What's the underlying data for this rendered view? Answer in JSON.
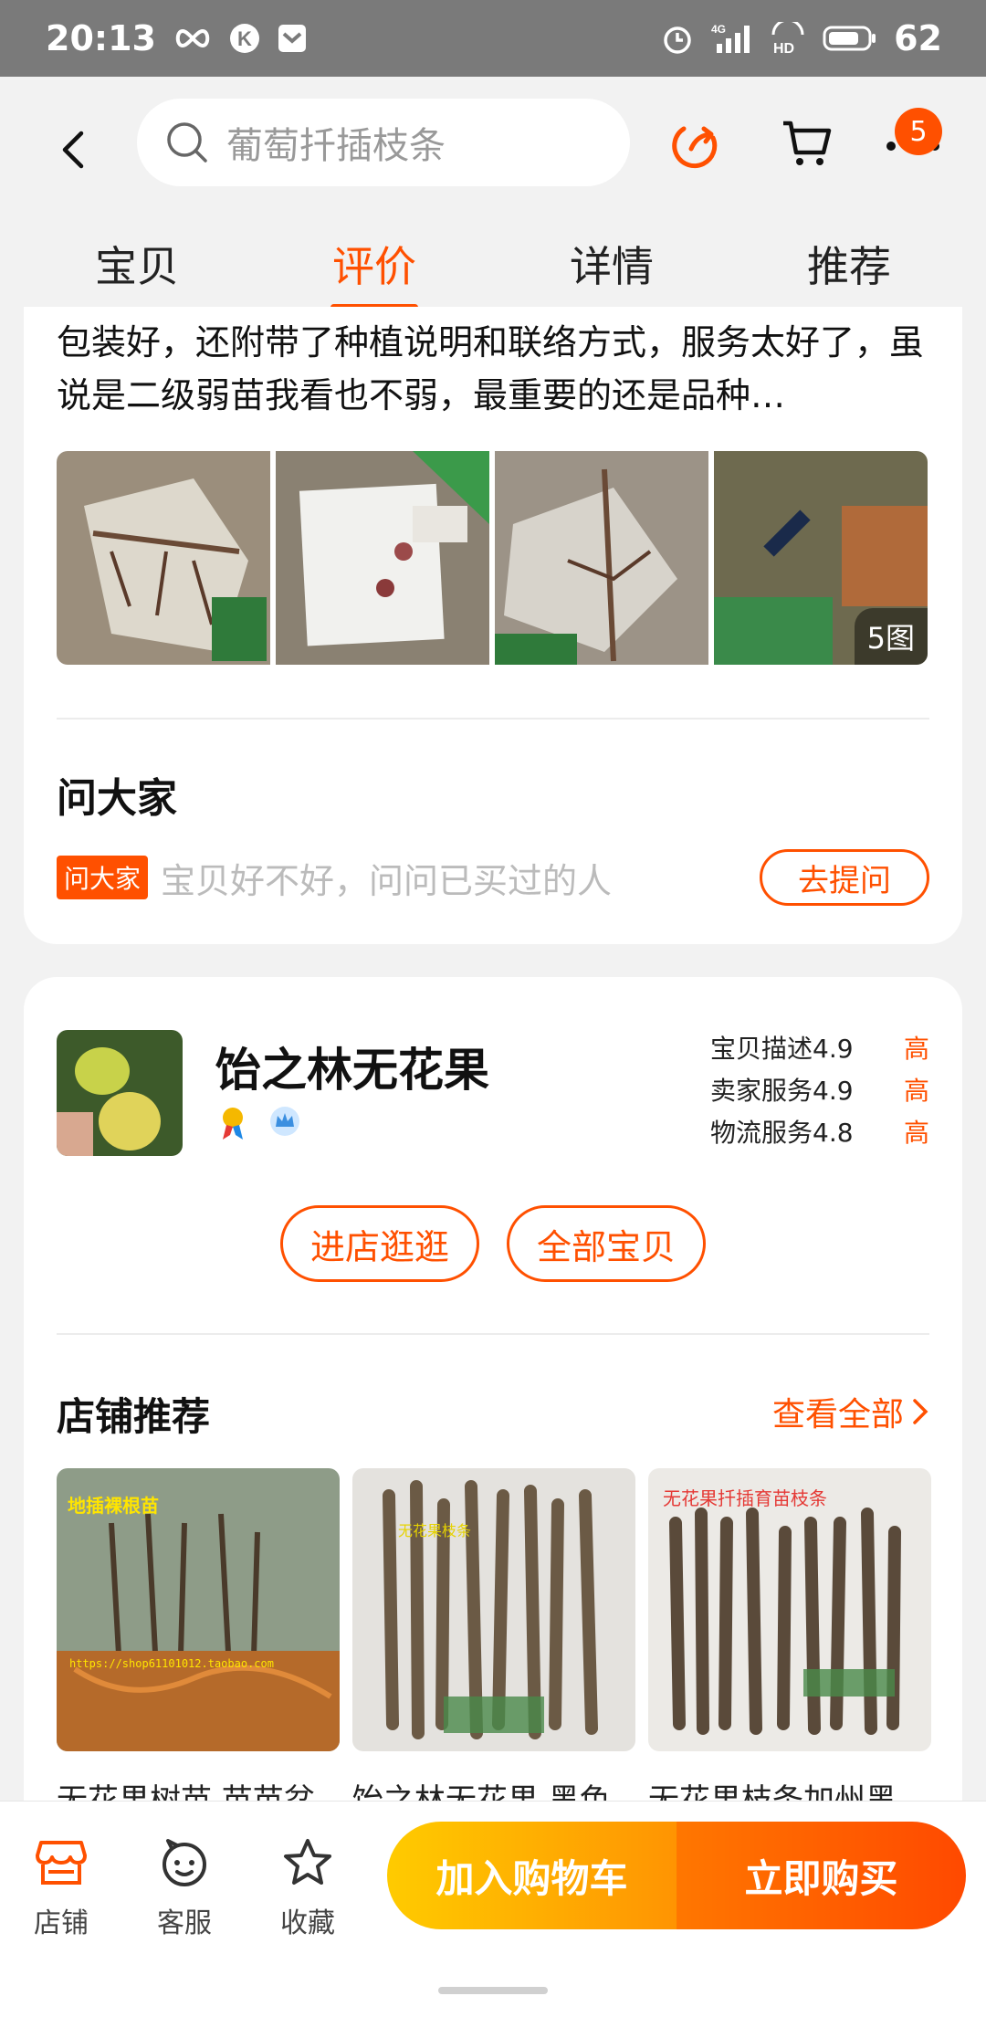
{
  "status_bar": {
    "time": "20:13",
    "battery": "62",
    "icons": [
      "infinity-icon",
      "k-app-icon",
      "mail-app-icon",
      "alarm-icon",
      "signal-4g-icon",
      "hd-icon",
      "battery-icon"
    ]
  },
  "header": {
    "search_placeholder": "葡萄扦插枝条",
    "cart_badge": "5"
  },
  "tabs": [
    {
      "label": "宝贝",
      "active": false
    },
    {
      "label": "评价",
      "active": true
    },
    {
      "label": "详情",
      "active": false
    },
    {
      "label": "推荐",
      "active": false
    }
  ],
  "review": {
    "text": "包装好，还附带了种植说明和联络方式，服务太好了，虽说是二级弱苗我看也不弱，最重要的还是品种…",
    "photo_count_label": "5图"
  },
  "ask": {
    "title": "问大家",
    "tag": "问大家",
    "hint": "宝贝好不好，问问已买过的人",
    "button": "去提问"
  },
  "shop": {
    "name": "饴之林无花果",
    "scores": [
      {
        "label": "宝贝描述",
        "value": "4.9",
        "level": "高"
      },
      {
        "label": "卖家服务",
        "value": "4.9",
        "level": "高"
      },
      {
        "label": "物流服务",
        "value": "4.8",
        "level": "高"
      }
    ],
    "enter_button": "进店逛逛",
    "all_items_button": "全部宝贝"
  },
  "recommend": {
    "title": "店铺推荐",
    "view_all": "查看全部",
    "items": [
      {
        "name": "无花果树苗 苗苗盆",
        "img_caption": "地插裸根苗",
        "img_url_text": "https://shop61101012.taobao.com"
      },
      {
        "name": "饴之林无花果 黑色",
        "img_caption": "无花果枝条"
      },
      {
        "name": "无花果枝条加州黑",
        "img_caption": "无花果扦插育苗枝条"
      }
    ]
  },
  "bottom_bar": {
    "store": "店铺",
    "service": "客服",
    "favorite": "收藏",
    "add_to_cart": "加入购物车",
    "buy_now": "立即购买"
  },
  "colors": {
    "accent": "#ff5000",
    "cart_gradient": [
      "#ffcb00",
      "#ff9402"
    ],
    "buy_gradient": [
      "#ff7700",
      "#ff4900"
    ]
  }
}
